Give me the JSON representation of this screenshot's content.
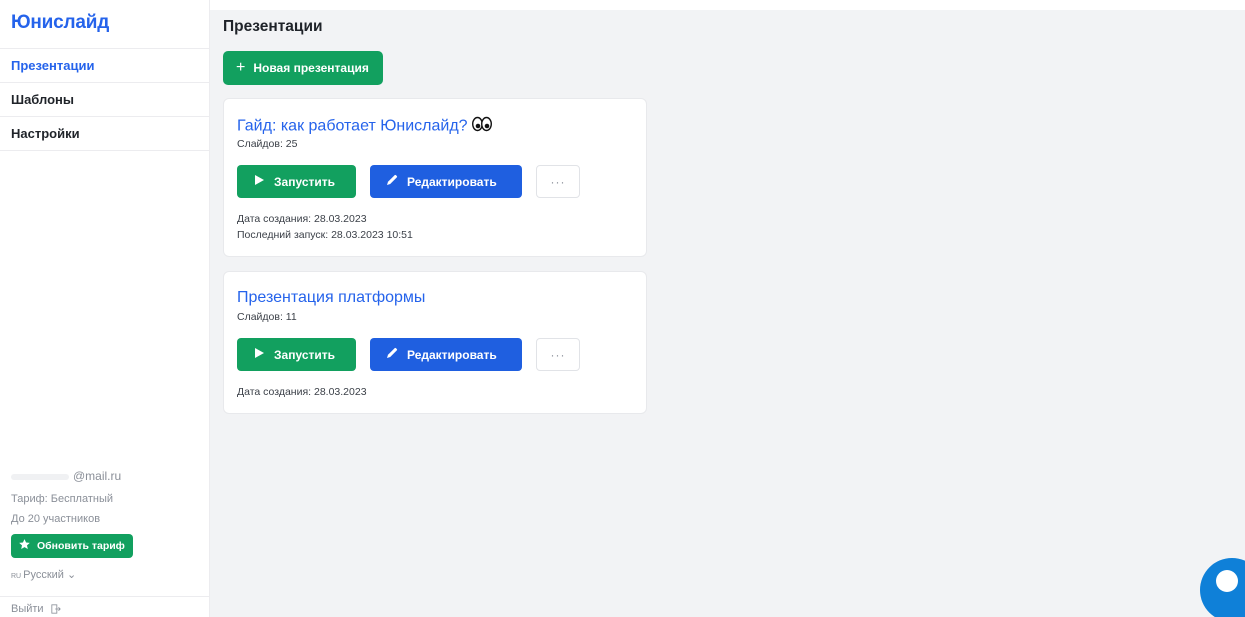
{
  "brand": "Юнислайд",
  "sidebar": {
    "items": [
      {
        "label": "Презентации",
        "active": true
      },
      {
        "label": "Шаблоны",
        "active": false
      },
      {
        "label": "Настройки",
        "active": false
      }
    ],
    "account": {
      "email": "@mail.ru",
      "plan": "Тариф: Бесплатный",
      "limit": "До 20 участников",
      "upgrade_label": "Обновить тариф",
      "language_code": "RU",
      "language": "Русский ⌄"
    },
    "logout_label": "Выйти"
  },
  "main": {
    "title": "Презентации",
    "new_button_label": "Новая презентация",
    "new_button_icon": "+",
    "presentations": [
      {
        "title": "Гайд: как работает Юнислайд?",
        "title_emoji": "eyes-icon",
        "slides": "Слайдов: 25",
        "launch_label": "Запустить",
        "edit_label": "Редактировать",
        "more_label": "···",
        "created": "Дата создания: 28.03.2023",
        "last_launch": "Последний запуск: 28.03.2023 10:51"
      },
      {
        "title": "Презентация платформы",
        "slides": "Слайдов: 11",
        "launch_label": "Запустить",
        "edit_label": "Редактировать",
        "more_label": "···",
        "created": "Дата создания: 28.03.2023"
      }
    ]
  },
  "colors": {
    "accent": "#2563eb",
    "success": "#12a05f",
    "edit": "#1f5fe0",
    "background": "#f2f3f5"
  }
}
